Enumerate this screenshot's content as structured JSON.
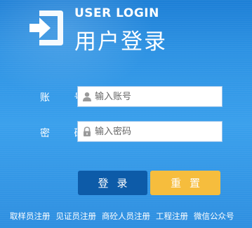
{
  "header": {
    "title_en": "USER LOGIN",
    "title_zh": "用户登录",
    "icon": "login-enter-icon"
  },
  "form": {
    "account_label": "账 号",
    "account_placeholder": "输入账号",
    "account_icon": "user-icon",
    "password_label": "密 码",
    "password_placeholder": "输入密码",
    "password_icon": "lock-icon"
  },
  "buttons": {
    "login": "登录",
    "reset": "重置"
  },
  "footer": {
    "links": [
      "取样员注册",
      "见证员注册",
      "商砼人员注册",
      "工程注册",
      "微信公众号"
    ]
  },
  "colors": {
    "background": "#2d92e3",
    "login_button": "#0d5ba8",
    "reset_button": "#f6bd3d",
    "text": "#ffffff"
  }
}
